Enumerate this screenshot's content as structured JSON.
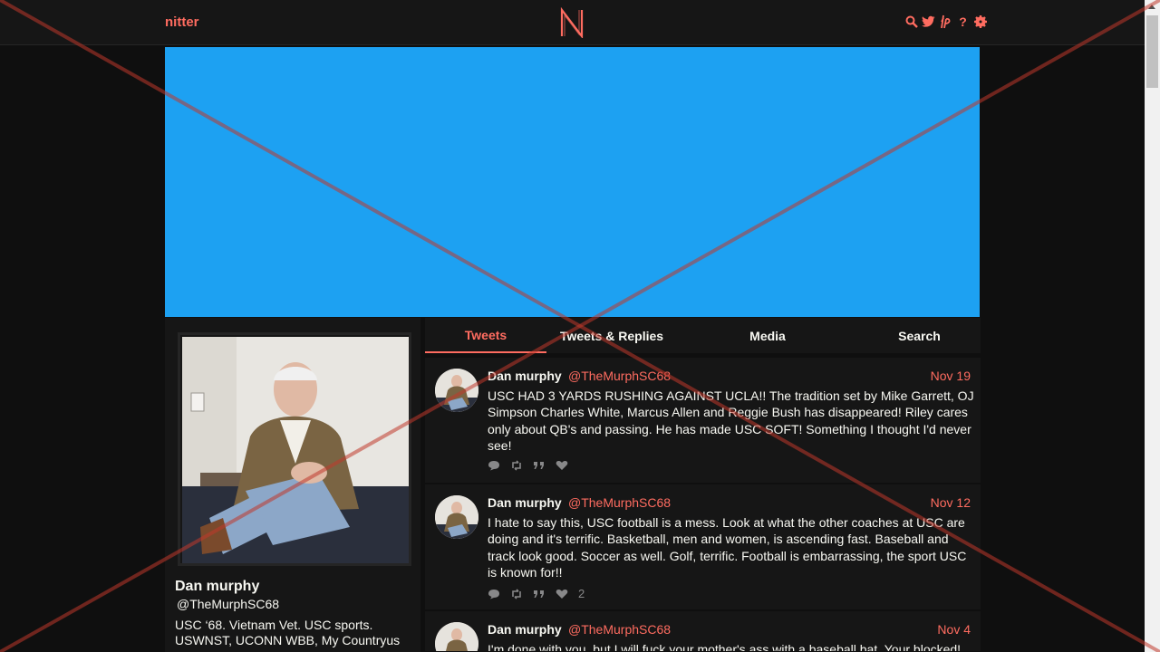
{
  "nav": {
    "brand": "nitter",
    "logo_letter": "N",
    "icons": [
      "search-icon",
      "twitter-icon",
      "lp-icon",
      "help-icon",
      "gear-icon"
    ],
    "help_glyph": "?"
  },
  "colors": {
    "accent": "#ff6c60",
    "banner": "#1da1f2",
    "background": "#0f0f0f",
    "panel": "#161616"
  },
  "profile": {
    "name": "Dan murphy",
    "handle": "@TheMurphSC68",
    "bio": "USC ‘68. Vietnam Vet. USC sports. USWNST, UCONN WBB, My Countryus"
  },
  "tabs": [
    {
      "label": "Tweets",
      "active": true
    },
    {
      "label": "Tweets & Replies",
      "active": false
    },
    {
      "label": "Media",
      "active": false
    },
    {
      "label": "Search",
      "active": false
    }
  ],
  "tweets": [
    {
      "name": "Dan murphy",
      "handle": "@TheMurphSC68",
      "date": "Nov 19",
      "text": "USC HAD 3 YARDS RUSHING AGAINST UCLA!! The tradition set by Mike Garrett, OJ Simpson  Charles White, Marcus Allen and Reggie Bush has disappeared! Riley cares only about QB's and passing. He has made USC SOFT! Something I thought I'd never see!",
      "likes": ""
    },
    {
      "name": "Dan murphy",
      "handle": "@TheMurphSC68",
      "date": "Nov 12",
      "text": "I hate to say this, USC football is a mess. Look at what the other coaches at USC are doing and it's terrific. Basketball, men and women, is ascending fast. Baseball and track look good. Soccer as well. Golf, terrific. Football is embarrassing, the sport USC is known for!!",
      "likes": "2"
    },
    {
      "name": "Dan murphy",
      "handle": "@TheMurphSC68",
      "date": "Nov 4",
      "text": "I'm done with you, but I will fuck your mother's ass with a baseball bat. Your blocked!",
      "likes": ""
    }
  ]
}
